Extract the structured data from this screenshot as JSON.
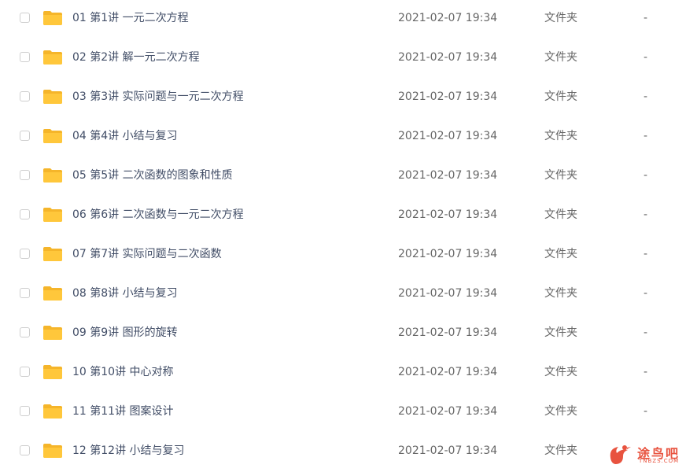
{
  "files": [
    {
      "name": "01 第1讲 一元二次方程",
      "date": "2021-02-07 19:34",
      "type": "文件夹",
      "size": "-",
      "icon": "folder-icon"
    },
    {
      "name": "02 第2讲 解一元二次方程",
      "date": "2021-02-07 19:34",
      "type": "文件夹",
      "size": "-",
      "icon": "folder-icon"
    },
    {
      "name": "03 第3讲 实际问题与一元二次方程",
      "date": "2021-02-07 19:34",
      "type": "文件夹",
      "size": "-",
      "icon": "folder-icon"
    },
    {
      "name": "04 第4讲 小结与复习",
      "date": "2021-02-07 19:34",
      "type": "文件夹",
      "size": "-",
      "icon": "folder-icon"
    },
    {
      "name": "05 第5讲 二次函数的图象和性质",
      "date": "2021-02-07 19:34",
      "type": "文件夹",
      "size": "-",
      "icon": "folder-icon"
    },
    {
      "name": "06 第6讲 二次函数与一元二次方程",
      "date": "2021-02-07 19:34",
      "type": "文件夹",
      "size": "-",
      "icon": "folder-icon"
    },
    {
      "name": "07 第7讲 实际问题与二次函数",
      "date": "2021-02-07 19:34",
      "type": "文件夹",
      "size": "-",
      "icon": "folder-icon"
    },
    {
      "name": "08 第8讲 小结与复习",
      "date": "2021-02-07 19:34",
      "type": "文件夹",
      "size": "-",
      "icon": "folder-icon"
    },
    {
      "name": "09 第9讲 图形的旋转",
      "date": "2021-02-07 19:34",
      "type": "文件夹",
      "size": "-",
      "icon": "folder-icon"
    },
    {
      "name": "10 第10讲 中心对称",
      "date": "2021-02-07 19:34",
      "type": "文件夹",
      "size": "-",
      "icon": "folder-icon"
    },
    {
      "name": "11 第11讲 图案设计",
      "date": "2021-02-07 19:34",
      "type": "文件夹",
      "size": "-",
      "icon": "folder-icon"
    },
    {
      "name": "12 第12讲 小结与复习",
      "date": "2021-02-07 19:34",
      "type": "文件夹",
      "size": "-",
      "icon": "folder-icon"
    }
  ],
  "watermark": {
    "text": "途鸟吧",
    "subtext": "TNBZS.COM",
    "color": "#e8533f"
  },
  "colors": {
    "folder": "#ffc73b",
    "folder_tab": "#f5b52a",
    "name_text": "#424e67",
    "meta_text": "#666666"
  }
}
